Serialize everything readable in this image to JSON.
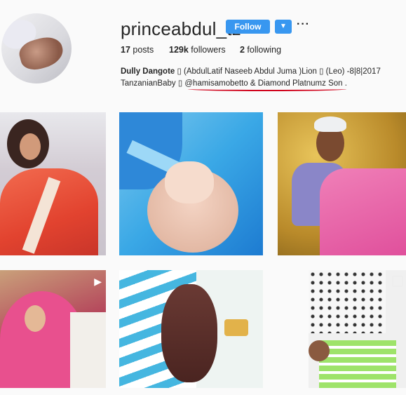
{
  "profile": {
    "username": "princeabdul_tz",
    "follow_label": "Follow",
    "dropdown_icon": "chevron-down-icon",
    "more_icon": "more-icon",
    "more_glyph": "···",
    "dropdown_glyph": "▼"
  },
  "stats": {
    "posts_count": "17",
    "posts_label": " posts",
    "followers_count": "129k",
    "followers_label": " followers",
    "following_count": "2",
    "following_label": " following"
  },
  "bio": {
    "name": "Dully Dangote",
    "line1_rest": " ▯ (AbdulLatif Naseeb Abdul Juma )Lion ▯ (Leo) -8|8|2017",
    "line2_a": "TanzanianBaby ▯ ",
    "line2_b": "@hamisamobetto & Diamond Platnumz Son ."
  },
  "colors": {
    "accent": "#3897f0",
    "underline": "#d0021b"
  },
  "posts": [
    {
      "label": "post-1"
    },
    {
      "label": "post-2"
    },
    {
      "label": "post-3"
    },
    {
      "label": "post-4",
      "icon": "video-icon"
    },
    {
      "label": "post-5"
    },
    {
      "label": "post-6",
      "icon": "carousel-icon"
    }
  ]
}
